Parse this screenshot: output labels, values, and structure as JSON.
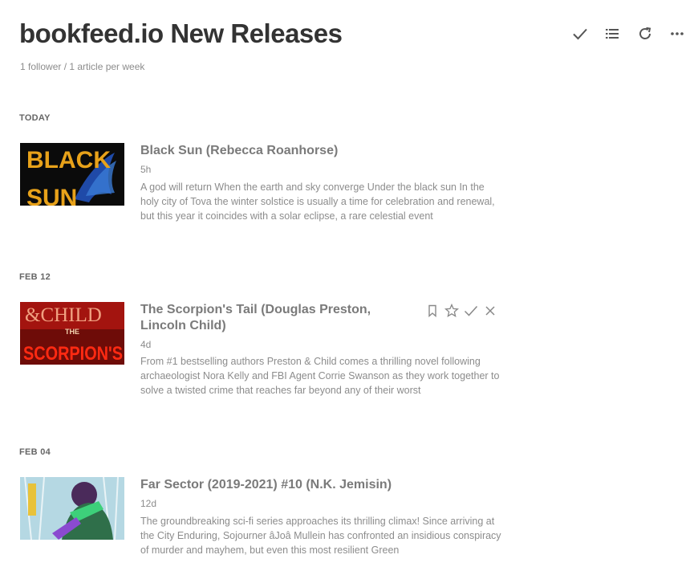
{
  "header": {
    "title": "bookfeed.io New Releases",
    "meta": "1 follower / 1 article per week"
  },
  "toolbar": {
    "buttons": [
      {
        "icon": "check-icon",
        "name": "mark-all-read-button"
      },
      {
        "icon": "list-view-icon",
        "name": "layout-button"
      },
      {
        "icon": "refresh-icon",
        "name": "refresh-button"
      },
      {
        "icon": "more-icon",
        "name": "more-button"
      }
    ]
  },
  "sections": [
    {
      "label": "TODAY",
      "entries": [
        {
          "title": "Black Sun (Rebecca Roanhorse)",
          "age": "5h",
          "summary": "A god will return When the earth and sky converge Under the black sun In the holy city of Tova the winter solstice is usually a time for celebration and renewal, but this year it coincides with a solar eclipse, a rare celestial event",
          "thumb_text": [
            "BLACK",
            "SUN"
          ]
        }
      ]
    },
    {
      "label": "FEB 12",
      "entries": [
        {
          "title": "The Scorpion's Tail (Douglas Preston, Lincoln Child)",
          "age": "4d",
          "summary": "From #1 bestselling authors Preston & Child comes a thrilling novel following archaeologist Nora Kelly and FBI Agent Corrie Swanson as they work together to solve a twisted crime that reaches far beyond any of their worst",
          "thumb_text": [
            "&CHILD",
            "THE",
            "SCORPION'S"
          ],
          "hover_actions": [
            "bookmark-icon",
            "star-icon",
            "check-icon",
            "close-icon"
          ]
        }
      ]
    },
    {
      "label": "FEB 04",
      "entries": [
        {
          "title": "Far Sector (2019-2021) #10 (N.K. Jemisin)",
          "age": "12d",
          "summary": "The groundbreaking sci-fi series approaches its thrilling climax! Since arriving at the City Enduring, Sojourner âJoâ Mullein has confronted an insidious conspiracy of murder and mayhem, but even this most resilient Green"
        }
      ]
    }
  ],
  "colors": {
    "title": "#333333",
    "entry_title": "#7a7a7a",
    "muted": "#8c8c8c",
    "icon": "#555555"
  }
}
